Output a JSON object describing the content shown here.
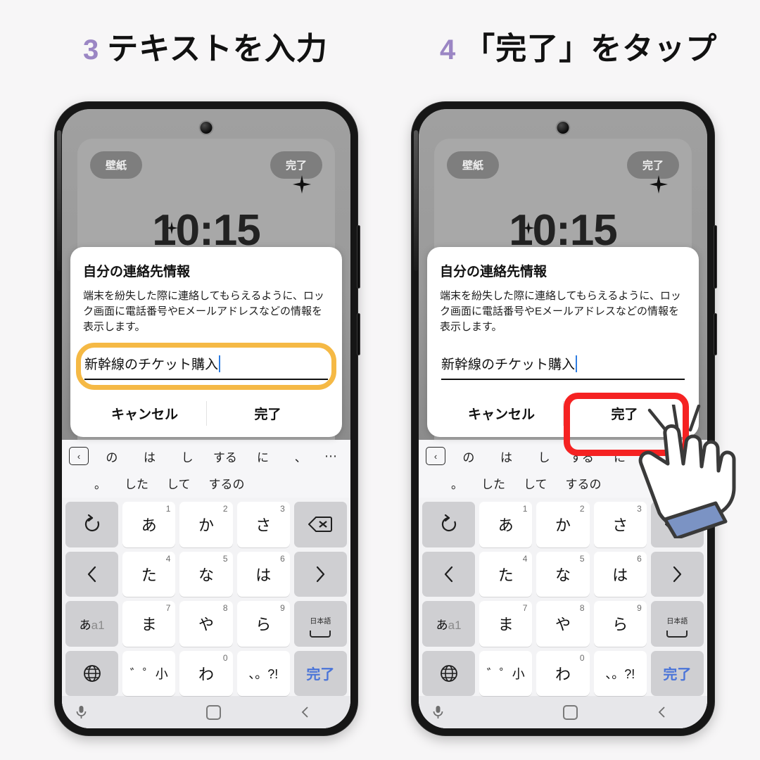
{
  "page": {
    "background_color": "#f7f6f7",
    "accent_purple": "#9b86c4",
    "highlight_orange": "#f5b945",
    "highlight_red": "#f52222",
    "keyboard_done_blue": "#4a74d8"
  },
  "steps": [
    {
      "number": "3",
      "title": "テキストを入力"
    },
    {
      "number": "4",
      "title": "「完了」をタップ"
    }
  ],
  "phone": {
    "lock_screen": {
      "wallpaper_button": "壁紙",
      "done_button": "完了",
      "clock": "10:15"
    },
    "dialog": {
      "title": "自分の連絡先情報",
      "body": "端末を紛失した際に連絡してもらえるように、ロック画面に電話番号やEメールアドレスなどの情報を表示します。",
      "input_value": "新幹線のチケット購入",
      "input_placeholder": "",
      "cancel_label": "キャンセル",
      "confirm_label": "完了"
    },
    "keyboard": {
      "suggestions_row1": [
        "の",
        "は",
        "し",
        "する",
        "に",
        "、"
      ],
      "suggestions_more": "⋯",
      "suggestions_row2": [
        "。",
        "した",
        "して",
        "するの"
      ],
      "rows": [
        [
          {
            "main": "↺",
            "corner": "",
            "type": "fn",
            "name": "undo-key"
          },
          {
            "main": "あ",
            "corner": "1",
            "type": "char",
            "name": "key-a"
          },
          {
            "main": "か",
            "corner": "2",
            "type": "char",
            "name": "key-ka"
          },
          {
            "main": "さ",
            "corner": "3",
            "type": "char",
            "name": "key-sa"
          },
          {
            "main": "⌫",
            "corner": "",
            "type": "fn",
            "name": "backspace-key"
          }
        ],
        [
          {
            "main": "‹",
            "corner": "",
            "type": "fn",
            "name": "cursor-left-key"
          },
          {
            "main": "た",
            "corner": "4",
            "type": "char",
            "name": "key-ta"
          },
          {
            "main": "な",
            "corner": "5",
            "type": "char",
            "name": "key-na"
          },
          {
            "main": "は",
            "corner": "6",
            "type": "char",
            "name": "key-ha"
          },
          {
            "main": "›",
            "corner": "",
            "type": "fn",
            "name": "cursor-right-key"
          }
        ],
        [
          {
            "main": "あa1",
            "corner": "",
            "type": "fn",
            "name": "input-mode-key"
          },
          {
            "main": "ま",
            "corner": "7",
            "type": "char",
            "name": "key-ma"
          },
          {
            "main": "や",
            "corner": "8",
            "type": "char",
            "name": "key-ya"
          },
          {
            "main": "ら",
            "corner": "9",
            "type": "char",
            "name": "key-ra"
          },
          {
            "main": "日本語",
            "corner": "",
            "type": "fn",
            "name": "space-key"
          }
        ],
        [
          {
            "main": "🌐",
            "corner": "",
            "type": "fn",
            "name": "globe-key"
          },
          {
            "main": "゛゜小",
            "corner": "",
            "type": "char",
            "name": "dakuten-key"
          },
          {
            "main": "わ",
            "corner": "0",
            "type": "char",
            "name": "key-wa"
          },
          {
            "main": "、。?!",
            "corner": "",
            "type": "char",
            "name": "punctuation-key"
          },
          {
            "main": "完了",
            "corner": "",
            "type": "fn",
            "name": "enter-done-key"
          }
        ]
      ]
    },
    "navbar": {
      "mic": "mic-icon",
      "home": "home-icon",
      "back": "back-icon"
    }
  }
}
